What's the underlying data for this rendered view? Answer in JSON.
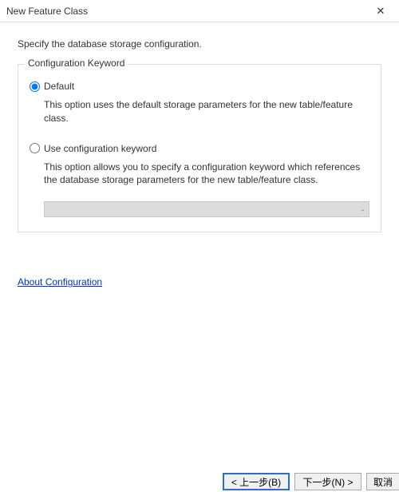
{
  "titlebar": {
    "title": "New Feature Class"
  },
  "content": {
    "instruction": "Specify the database storage configuration.",
    "fieldset_legend": "Configuration Keyword",
    "option_default": {
      "label": "Default",
      "description": "This option uses the default storage parameters for the new table/feature class."
    },
    "option_custom": {
      "label": "Use configuration keyword",
      "description": "This option allows you to specify a configuration keyword which references the database storage parameters for the new table/feature class."
    },
    "link": "About Configuration "
  },
  "buttons": {
    "back": "< 上一步(B)",
    "next": "下一步(N) >",
    "cancel": "取消"
  }
}
